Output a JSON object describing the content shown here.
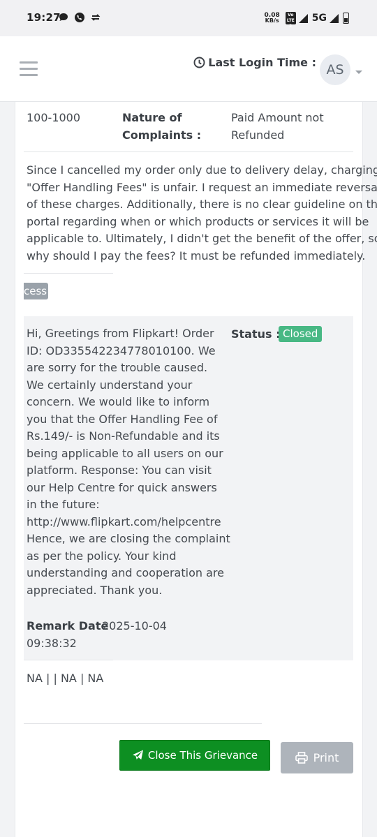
{
  "status_bar": {
    "time": "19:27",
    "network_speed_value": "0.08",
    "network_speed_unit": "KB/s",
    "volte_label": "Vo LTE 2",
    "network_type": "5G"
  },
  "header": {
    "last_login_label": "Last Login Time :",
    "avatar_initials": "AS"
  },
  "complaint": {
    "amount_range": "100-1000",
    "nature_label_line1": "Nature of",
    "nature_label_line2": "Complaints :",
    "nature_value_line1": "Paid Amount not",
    "nature_value_line2": "Refunded",
    "description_lines": [
      "Since I cancelled my order only due to delivery delay, charging",
      "\"Offer Handling Fees\" is unfair. I request an immediate reversal",
      "of these charges. Additionally, there is no clear guideline on the",
      "portal regarding when or which products or services it will be",
      "applicable to. Ultimately, I didn't get the benefit of the offer, so",
      "why should I pay the fees? It must be refunded immediately."
    ],
    "stage_badge": "cess"
  },
  "remark": {
    "text_lines": [
      "Hi, Greetings from Flipkart! Order",
      "ID: OD335542234778010100. We",
      "are sorry for the trouble caused.",
      "We certainly understand your",
      "concern. We would like to inform",
      "you that the Offer Handling Fee of",
      "Rs.149/- is Non-Refundable and its",
      "being applicable to all users on our",
      "platform. Response: You can visit",
      "our Help Centre for quick answers",
      "in the future:",
      "http://www.flipkart.com/helpcentre",
      "Hence, we are closing the complaint",
      "as per the policy. Your kind",
      "understanding and cooperation are",
      "appreciated. Thank you."
    ],
    "status_label": "Status :",
    "status_value": "Closed",
    "remark_date_label": "Remark Date",
    "remark_date_part1": "2025-10-04",
    "remark_date_part2": "09:38:32"
  },
  "footer_info": "NA | | NA | NA",
  "actions": {
    "close_button_label": "Close This Grievance",
    "print_button_label": "Print"
  },
  "colors": {
    "accent_green": "#0d8f22",
    "status_closed": "#48b884",
    "print_disabled": "#aeb4bb"
  }
}
